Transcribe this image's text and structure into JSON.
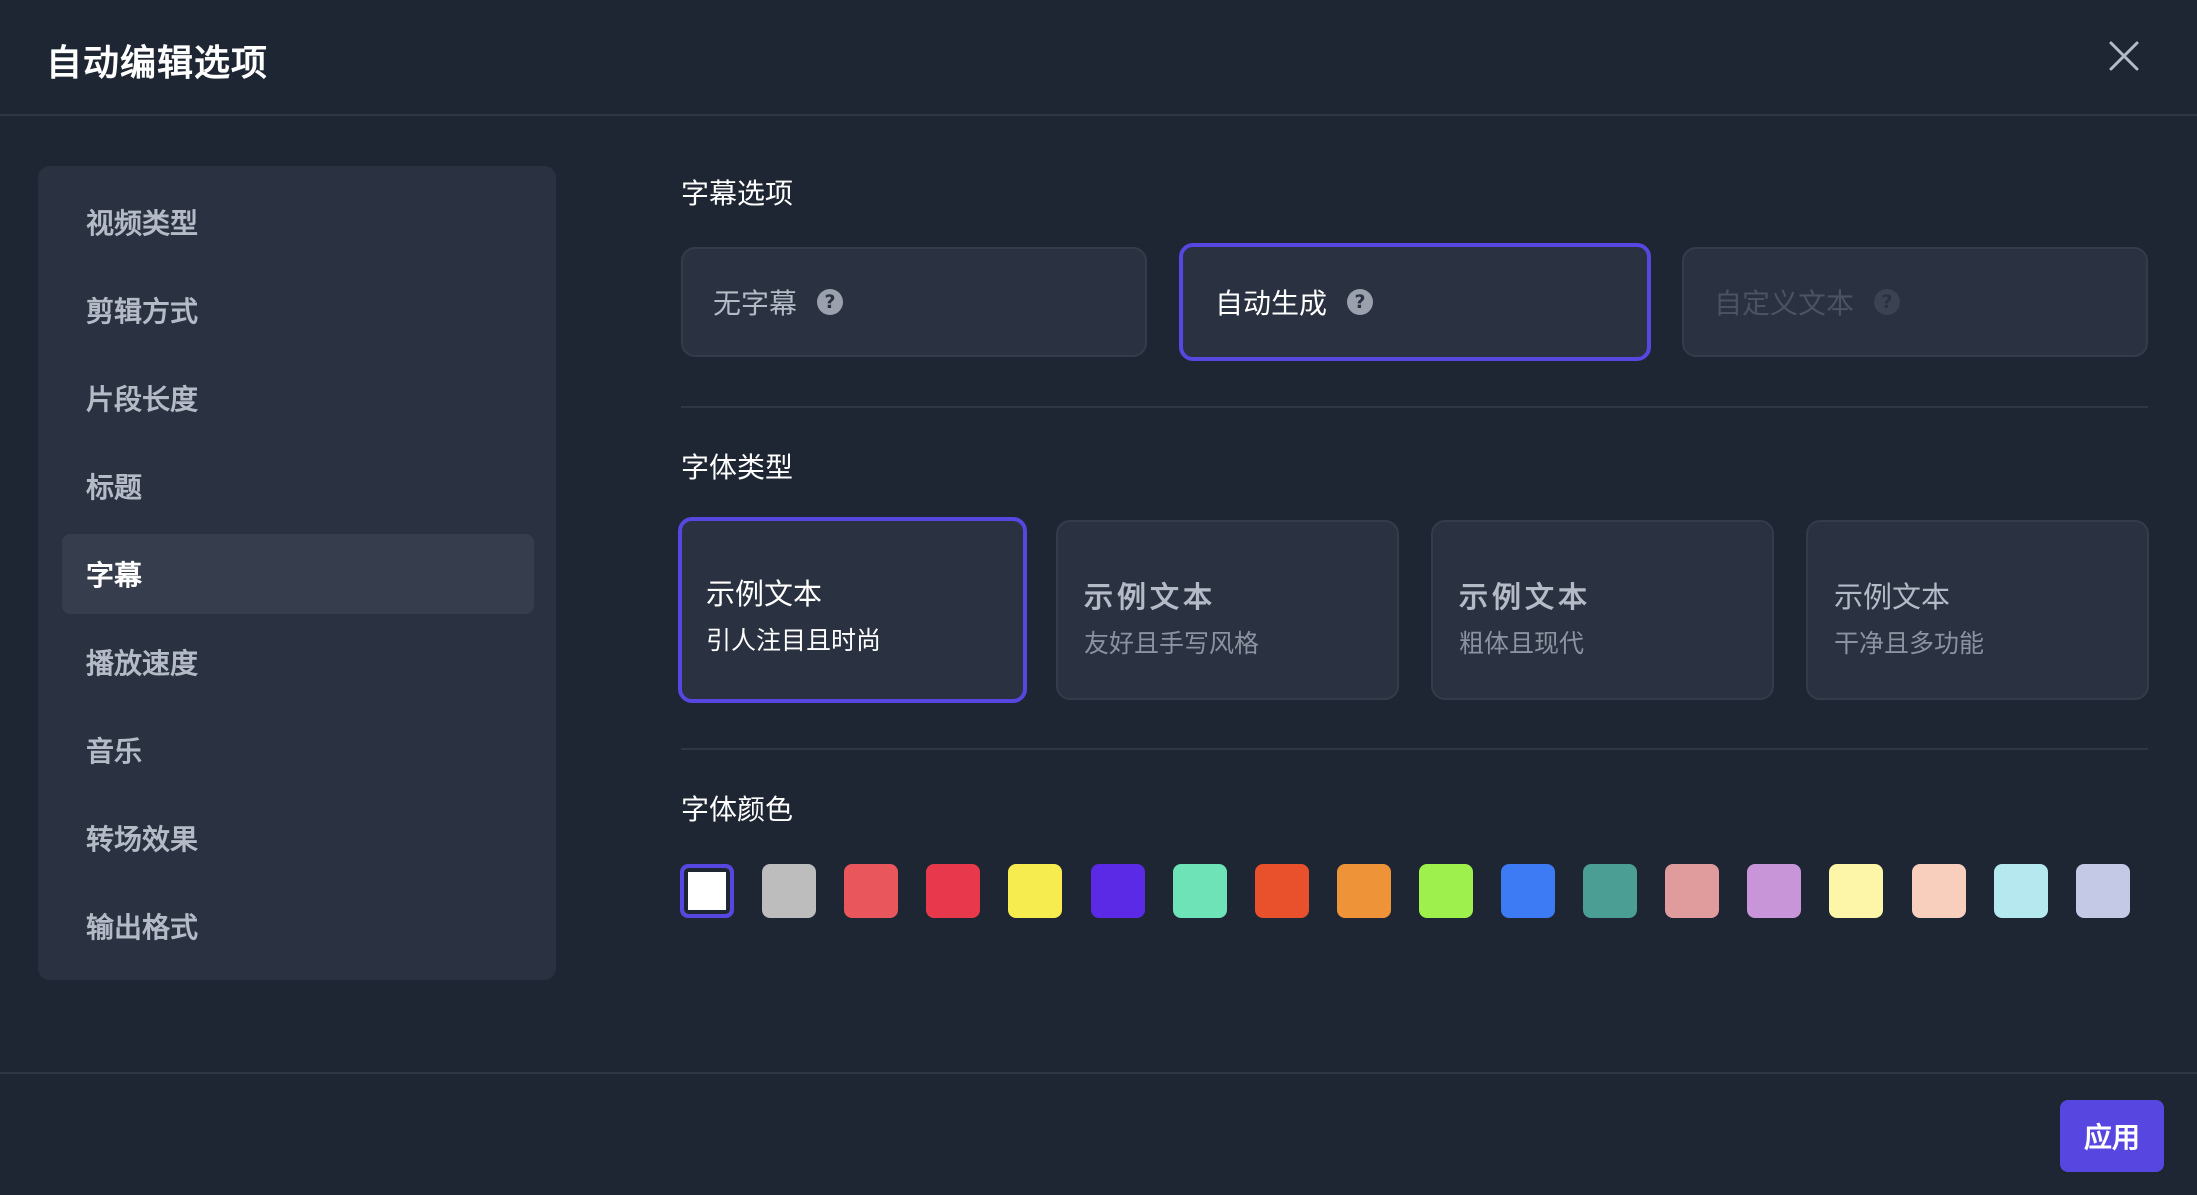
{
  "dialog": {
    "title": "自动编辑选项",
    "close_icon": "close-icon"
  },
  "sidebar": {
    "items": [
      {
        "label": "视频类型",
        "active": false
      },
      {
        "label": "剪辑方式",
        "active": false
      },
      {
        "label": "片段长度",
        "active": false
      },
      {
        "label": "标题",
        "active": false
      },
      {
        "label": "字幕",
        "active": true
      },
      {
        "label": "播放速度",
        "active": false
      },
      {
        "label": "音乐",
        "active": false
      },
      {
        "label": "转场效果",
        "active": false
      },
      {
        "label": "输出格式",
        "active": false
      }
    ]
  },
  "subtitle_options": {
    "title": "字幕选项",
    "options": [
      {
        "label": "无字幕",
        "help_icon": "help-icon",
        "state": "normal"
      },
      {
        "label": "自动生成",
        "help_icon": "help-icon",
        "state": "selected"
      },
      {
        "label": "自定义文本",
        "help_icon": "help-icon",
        "state": "disabled"
      }
    ],
    "help_glyph": "?"
  },
  "font_type": {
    "title": "字体类型",
    "cards": [
      {
        "sample": "示例文本",
        "description": "引人注目且时尚",
        "selected": true
      },
      {
        "sample": "示例文本",
        "description": "友好且手写风格",
        "selected": false
      },
      {
        "sample": "示例文本",
        "description": "粗体且现代",
        "selected": false
      },
      {
        "sample": "示例文本",
        "description": "干净且多功能",
        "selected": false
      }
    ]
  },
  "font_color": {
    "title": "字体颜色",
    "selected_index": 0,
    "swatches": [
      "#ffffff",
      "#bdbdbd",
      "#e9565b",
      "#e8384b",
      "#f6eb4f",
      "#5b2ae6",
      "#6ee3b8",
      "#e9502c",
      "#ee9337",
      "#9ef14c",
      "#3d7bf4",
      "#4a9e94",
      "#e09b9d",
      "#c795d8",
      "#fdf5a8",
      "#f8cfbd",
      "#b5e8ef",
      "#c4c9e6"
    ]
  },
  "footer": {
    "apply_label": "应用"
  },
  "colors": {
    "accent": "#5746e0",
    "background": "#1f2633",
    "panel": "#2a3140"
  }
}
